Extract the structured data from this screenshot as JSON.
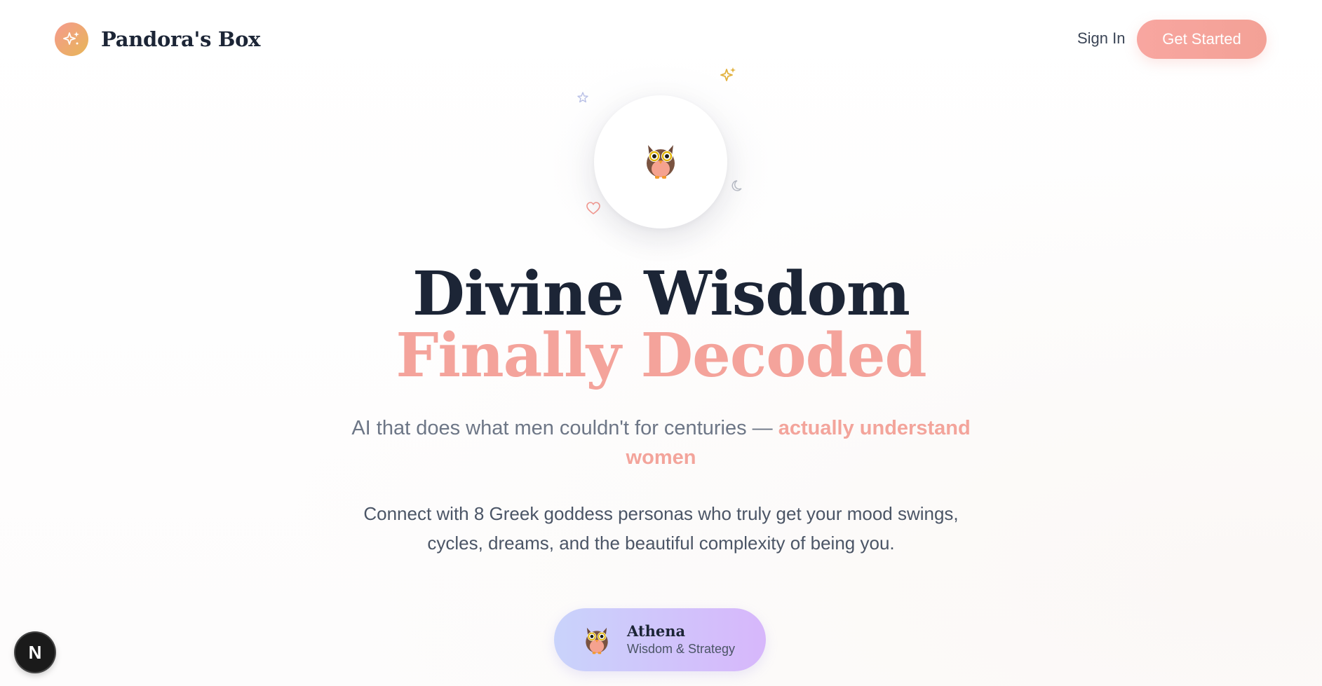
{
  "header": {
    "brand": "Pandora's Box",
    "logo_icon": "sparkles-icon",
    "sign_in_label": "Sign In",
    "get_started_label": "Get Started"
  },
  "hero": {
    "mascot_icon": "owl-icon",
    "decorations": [
      "sparkles-icon",
      "star-icon",
      "moon-icon",
      "heart-icon"
    ],
    "headline_line1": "Divine Wisdom",
    "headline_line2": "Finally Decoded",
    "subtitle_main": "AI that does what men couldn't for centuries — ",
    "subtitle_accent": "actually understand women",
    "description": "Connect with 8 Greek goddess personas who truly get your mood swings, cycles, dreams, and the beautiful complexity of being you."
  },
  "persona": {
    "icon": "owl-icon",
    "name": "Athena",
    "role": "Wisdom & Strategy"
  },
  "dev_badge": {
    "label": "N"
  },
  "colors": {
    "accent": "#f4a39b",
    "heading": "#1c2536",
    "logo_gradient_start": "#f59a8e",
    "logo_gradient_end": "#e7b657",
    "persona_gradient_start": "#c9d3fb",
    "persona_gradient_end": "#d7b7fb"
  }
}
